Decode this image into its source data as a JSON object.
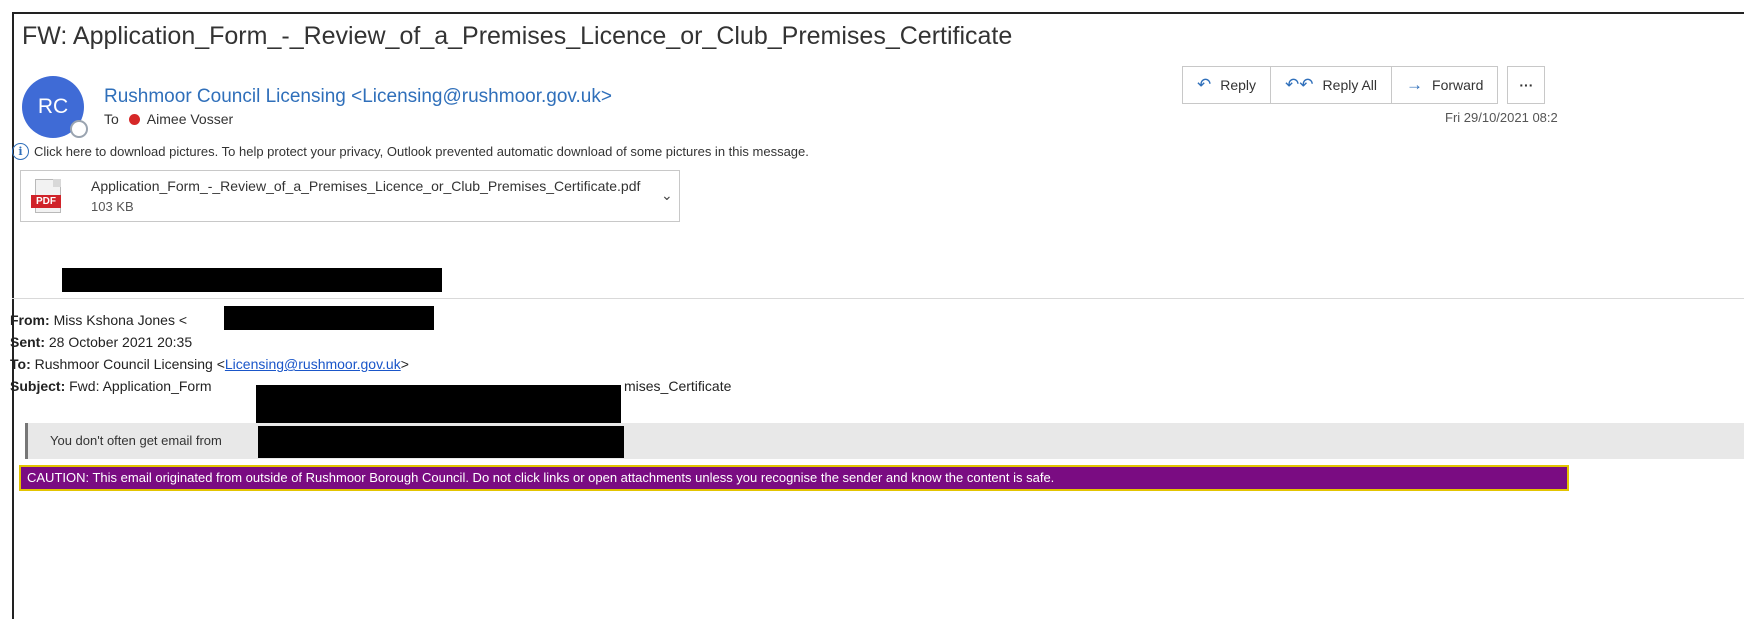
{
  "email": {
    "subject": "FW: Application_Form_-_Review_of_a_Premises_Licence_or_Club_Premises_Certificate",
    "avatar_initials": "RC",
    "sender": "Rushmoor Council Licensing <Licensing@rushmoor.gov.uk>",
    "to_label": "To",
    "recipient": "Aimee Vosser",
    "date": "Fri 29/10/2021 08:2",
    "info_bar": "Click here to download pictures. To help protect your privacy, Outlook prevented automatic download of some pictures in this message."
  },
  "attachment": {
    "badge": "PDF",
    "name": "Application_Form_-_Review_of_a_Premises_Licence_or_Club_Premises_Certificate.pdf",
    "size": "103 KB"
  },
  "actions": {
    "reply": "Reply",
    "reply_all": "Reply All",
    "forward": "Forward",
    "more": "···"
  },
  "forwarded": {
    "from_label": "From:",
    "from_value": "Miss Kshona Jones <",
    "sent_label": "Sent:",
    "sent_value": "28 October 2021 20:35",
    "to_label": "To:",
    "to_value": "Rushmoor Council Licensing <",
    "to_link": "Licensing@rushmoor.gov.uk",
    "to_close": ">",
    "subject_label": "Subject:",
    "subject_start": "Fwd: Application_Form",
    "subject_end": "mises_Certificate"
  },
  "notice_text": "You don't often get email from",
  "caution_text": "CAUTION: This email originated from outside of Rushmoor Borough Council. Do not click links or open attachments unless you recognise the sender and know the content is safe.",
  "colors": {
    "accent": "#2f6fba",
    "avatar": "#3f6bd6",
    "caution_bg": "#7a0c82",
    "caution_border": "#e3c400",
    "presence_dot": "#d62828"
  }
}
